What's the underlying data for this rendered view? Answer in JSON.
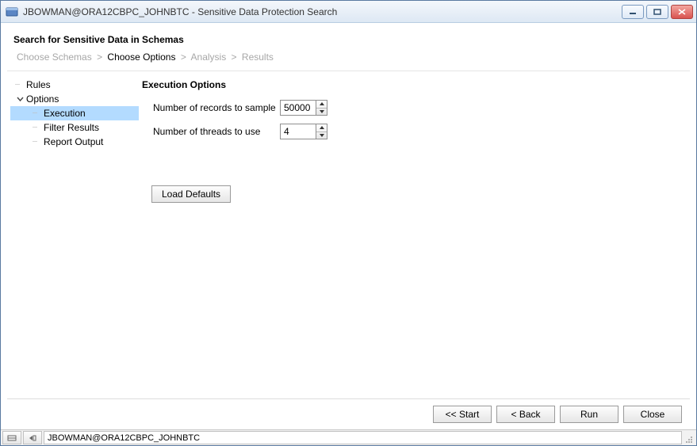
{
  "window": {
    "title": "JBOWMAN@ORA12CBPC_JOHNBTC - Sensitive Data Protection Search"
  },
  "header": {
    "title": "Search for Sensitive Data in Schemas"
  },
  "breadcrumb": {
    "step1": "Choose Schemas",
    "step2": "Choose Options",
    "step3": "Analysis",
    "step4": "Results"
  },
  "tree": {
    "rules": "Rules",
    "options": "Options",
    "execution": "Execution",
    "filter_results": "Filter Results",
    "report_output": "Report Output"
  },
  "main": {
    "section_title": "Execution Options",
    "records_label": "Number of records to sample",
    "records_value": "50000",
    "threads_label": "Number of threads to use",
    "threads_value": "4",
    "load_defaults": "Load Defaults"
  },
  "footer": {
    "start": "<< Start",
    "back": "< Back",
    "run": "Run",
    "close": "Close"
  },
  "status": {
    "connection": "JBOWMAN@ORA12CBPC_JOHNBTC"
  }
}
